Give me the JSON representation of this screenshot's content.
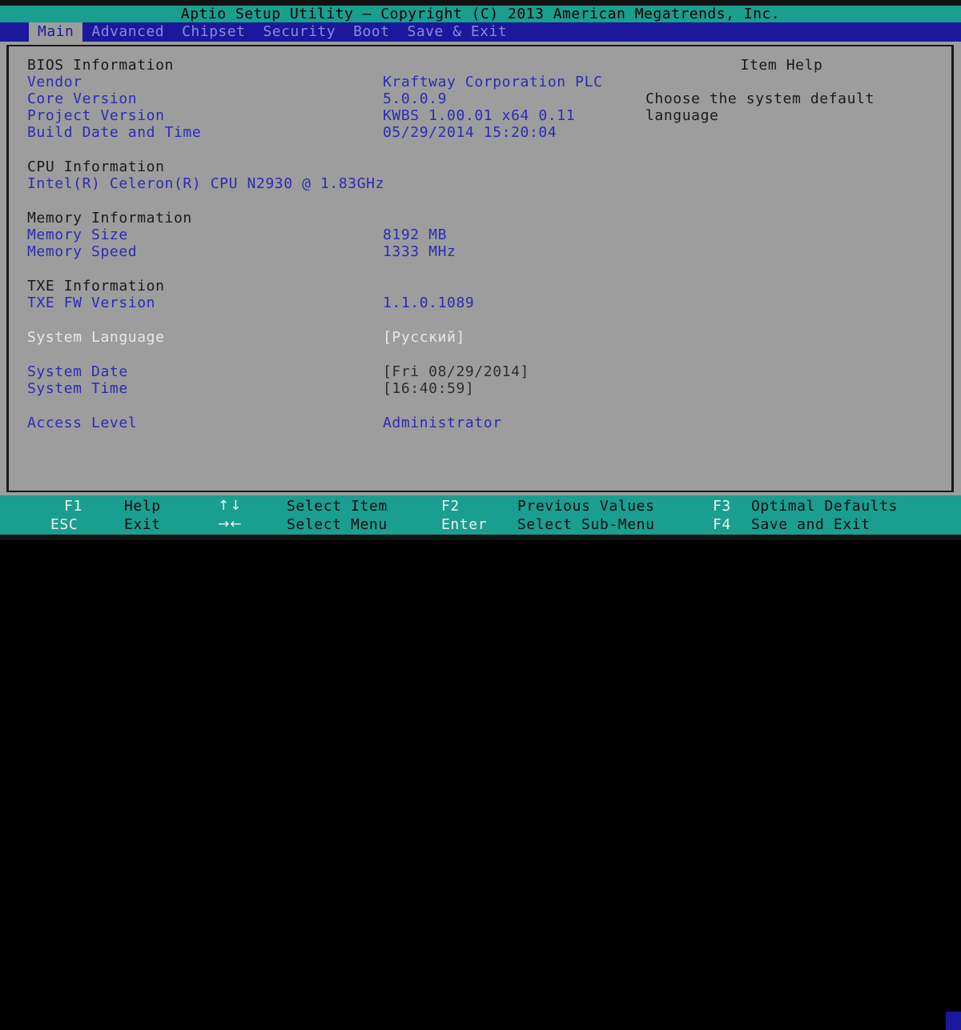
{
  "title_bar": {
    "text": "Aptio Setup Utility – Copyright (C) 2013 American Megatrends, Inc."
  },
  "menu_bar": {
    "items": [
      {
        "label": "Main",
        "active": true
      },
      {
        "label": "Advanced",
        "active": false
      },
      {
        "label": "Chipset",
        "active": false
      },
      {
        "label": "Security",
        "active": false
      },
      {
        "label": "Boot",
        "active": false
      },
      {
        "label": "Save & Exit",
        "active": false
      }
    ]
  },
  "main": {
    "bios_information": {
      "heading": "BIOS Information",
      "rows": [
        {
          "label": "Vendor",
          "value": "Kraftway Corporation PLC"
        },
        {
          "label": "Core Version",
          "value": "5.0.0.9"
        },
        {
          "label": "Project Version",
          "value": "KWBS 1.00.01 x64 0.11"
        },
        {
          "label": "Build Date and Time",
          "value": "05/29/2014 15:20:04"
        }
      ]
    },
    "cpu_information": {
      "heading": "CPU Information",
      "detail": "Intel(R) Celeron(R) CPU N2930 @ 1.83GHz"
    },
    "memory_information": {
      "heading": "Memory Information",
      "rows": [
        {
          "label": "Memory Size",
          "value": "8192 MB"
        },
        {
          "label": "Memory Speed",
          "value": "1333 MHz"
        }
      ]
    },
    "txe_information": {
      "heading": "TXE Information",
      "rows": [
        {
          "label": "TXE FW Version",
          "value": "1.1.0.1089"
        }
      ]
    },
    "system_language": {
      "label": "System Language",
      "value": "[Русский]"
    },
    "system_date": {
      "label": "System Date",
      "value": "[Fri 08/29/2014]"
    },
    "system_time": {
      "label": "System Time",
      "value": "[16:40:59]"
    },
    "access_level": {
      "label": "Access Level",
      "value": "Administrator"
    }
  },
  "item_help": {
    "title": "Item Help",
    "line1": "Choose the system default",
    "line2": "language"
  },
  "footer": {
    "row1": [
      {
        "key": "F1",
        "desc": "Help"
      },
      {
        "key": "↑↓",
        "desc": "Select Item"
      },
      {
        "key": "F2",
        "desc": "Previous Values"
      },
      {
        "key": "F3",
        "desc": "Optimal Defaults"
      }
    ],
    "row2": [
      {
        "key": "ESC",
        "desc": "Exit"
      },
      {
        "key": "→←",
        "desc": "Select Menu"
      },
      {
        "key": "Enter",
        "desc": "Select Sub-Menu"
      },
      {
        "key": "F4",
        "desc": "Save and Exit"
      }
    ]
  },
  "colors": {
    "title_bar_bg": "#1a9e8f",
    "menu_bar_bg": "#1b189c",
    "panel_bg": "#9d9d9d",
    "label_blue": "#2b2bb5",
    "heading_black": "#1a1a1a",
    "selected_white": "#e8e8e8",
    "footer_bg": "#1a9e8f"
  }
}
